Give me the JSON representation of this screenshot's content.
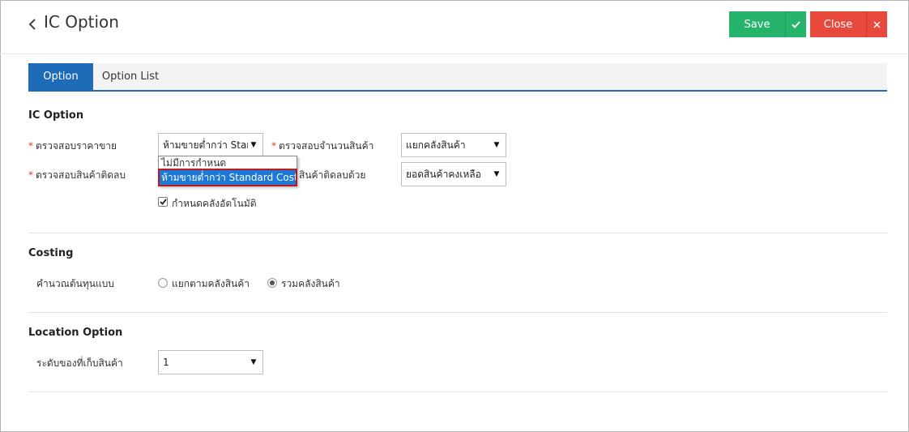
{
  "header": {
    "title": "IC Option",
    "save_label": "Save",
    "close_label": "Close"
  },
  "tabs": [
    {
      "label": "Option"
    },
    {
      "label": "Option List"
    }
  ],
  "ic_option": {
    "title": "IC Option",
    "required_mark": "*",
    "price_check_label": "ตรวจสอบราคาขาย",
    "price_check_value": "ห้ามขายต่ำกว่า Standard Cost",
    "qty_check_label": "ตรวจสอบจำนวนสินค้า",
    "qty_check_value": "แยกคลังสินค้า",
    "negative_check_label": "ตรวจสอบสินค้าติดลบ",
    "negative_check_label2": "สินค้าติดลบด้วย",
    "negative_check_value": "ยอดสินค้าคงเหลือ",
    "dropdown_options": [
      "ไม่มีการกำหนด",
      "ห้ามขายต่ำกว่า Standard Cost"
    ],
    "auto_warehouse_label": "กำหนดคลังอัตโนมัติ",
    "auto_warehouse_checked": true
  },
  "costing": {
    "title": "Costing",
    "method_label": "คำนวณต้นทุนแบบ",
    "options": [
      "แยกตามคลังสินค้า",
      "รวมคลังสินค้า"
    ],
    "selected": "รวมคลังสินค้า"
  },
  "location": {
    "title": "Location Option",
    "level_label": "ระดับของที่เก็บสินค้า",
    "level_value": "1"
  },
  "colors": {
    "save": "#26b36b",
    "close": "#e8493d",
    "tab_active": "#1e6cb8",
    "required": "#e23b2e"
  }
}
